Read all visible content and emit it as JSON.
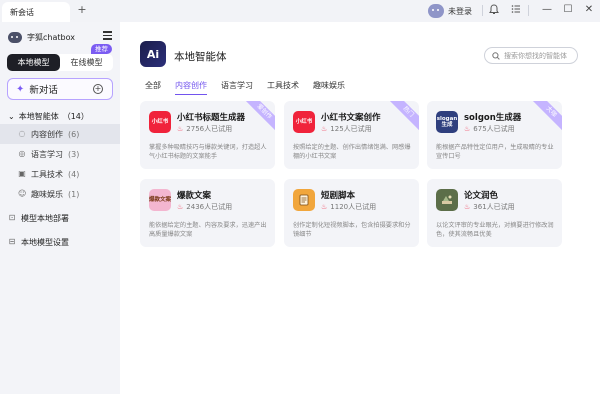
{
  "titlebar": {
    "tab_title": "新会话",
    "add_tab": "+",
    "login_status": "未登录",
    "window_controls": {
      "minimize": "—",
      "maximize": "☐",
      "close": "✕"
    }
  },
  "sidebar": {
    "brand": "字狐chatbox",
    "modes": {
      "local": "本地模型",
      "online": "在线模型",
      "recommend_badge": "推荐"
    },
    "new_chat": "新对话",
    "group": {
      "label": "本地智能体",
      "count": "（14）"
    },
    "items": [
      {
        "label": "内容创作",
        "count": "(6)",
        "icon": "lightbulb-icon"
      },
      {
        "label": "语言学习",
        "count": "(3)",
        "icon": "globe-icon"
      },
      {
        "label": "工具技术",
        "count": "(4)",
        "icon": "tools-icon"
      },
      {
        "label": "趣味娱乐",
        "count": "(1)",
        "icon": "smile-icon"
      }
    ],
    "links": [
      {
        "label": "模型本地部署",
        "icon": "deploy-icon"
      },
      {
        "label": "本地模型设置",
        "icon": "settings-icon"
      }
    ]
  },
  "main": {
    "logo_text": "Ai",
    "title": "本地智能体",
    "search_placeholder": "搜索你想找的智能体",
    "tabs": [
      "全部",
      "内容创作",
      "语言学习",
      "工具技术",
      "趣味娱乐"
    ],
    "active_tab": "内容创作",
    "cards": [
      {
        "title": "小红书标题生成器",
        "uses": "2756人已试用",
        "desc": "掌握多种吸睛技巧与爆款关键词，打造超人气小红书标题的文案能手",
        "icon_text": "小红书",
        "icon_color": "#f0233b",
        "ribbon": "爱创作"
      },
      {
        "title": "小红书文案创作",
        "uses": "125人已试用",
        "desc": "按照给定的主题、创作出情绪饱满、网感爆棚的小红书文案",
        "icon_text": "小红书",
        "icon_color": "#f0233b",
        "ribbon": "热门"
      },
      {
        "title": "solgon生成器",
        "uses": "675人已试用",
        "desc": "能根据产品特性定位用户，生成吸睛的专业宣传口号",
        "icon_text": "slogan生成",
        "icon_color": "#2f3f7e",
        "ribbon": "大咖"
      },
      {
        "title": "爆款文案",
        "uses": "2436人已试用",
        "desc": "能依据给定的主题、内容及要求，迅速产出高质量爆款文案",
        "icon_text": "爆款文案",
        "icon_color": "#f3b6d0",
        "ribbon": ""
      },
      {
        "title": "短剧脚本",
        "uses": "1120人已试用",
        "desc": "创作定制化短视频脚本，包含拍摄要求和分镜细节",
        "icon_text": "",
        "icon_color": "#f1a63c",
        "ribbon": ""
      },
      {
        "title": "论文润色",
        "uses": "361人已试用",
        "desc": "以论文评审的专业眼光，对摘要进行修改润色，使其流畅且优美",
        "icon_text": "",
        "icon_color": "#5c6e49",
        "ribbon": ""
      }
    ]
  }
}
